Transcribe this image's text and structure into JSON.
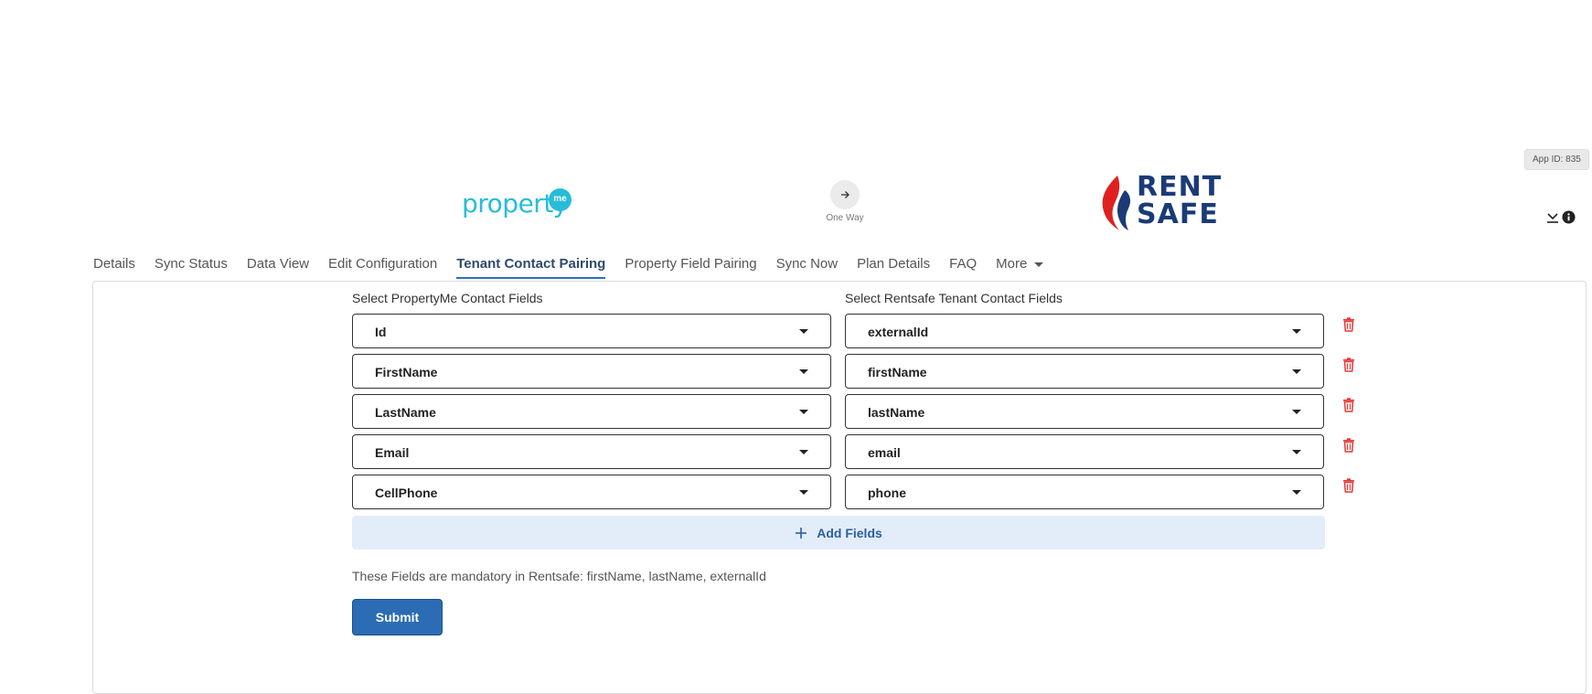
{
  "app_id": "App ID: 835",
  "logos": {
    "source_text": "property",
    "source_badge": "me",
    "target_line1": "RENT",
    "target_line2": "SAFE"
  },
  "sync": {
    "direction_label": "One Way"
  },
  "tabs": [
    {
      "label": "Details"
    },
    {
      "label": "Sync Status"
    },
    {
      "label": "Data View"
    },
    {
      "label": "Edit Configuration"
    },
    {
      "label": "Tenant Contact Pairing",
      "active": true
    },
    {
      "label": "Property Field Pairing"
    },
    {
      "label": "Sync Now"
    },
    {
      "label": "Plan Details"
    },
    {
      "label": "FAQ"
    },
    {
      "label": "More"
    }
  ],
  "pairing": {
    "left_label": "Select PropertyMe Contact Fields",
    "right_label": "Select Rentsafe Tenant Contact Fields",
    "rows": [
      {
        "left": "Id",
        "right": "externalId"
      },
      {
        "left": "FirstName",
        "right": "firstName"
      },
      {
        "left": "LastName",
        "right": "lastName"
      },
      {
        "left": "Email",
        "right": "email"
      },
      {
        "left": "CellPhone",
        "right": "phone"
      }
    ],
    "add_label": "Add Fields",
    "note": "These Fields are mandatory in Rentsafe: firstName, lastName, externalId",
    "submit_label": "Submit"
  },
  "colors": {
    "accent": "#2b6cb5",
    "danger": "#e53935",
    "propertyme": "#28bcd9",
    "rentsafe_blue": "#1a3b77",
    "rentsafe_red": "#e02020"
  }
}
